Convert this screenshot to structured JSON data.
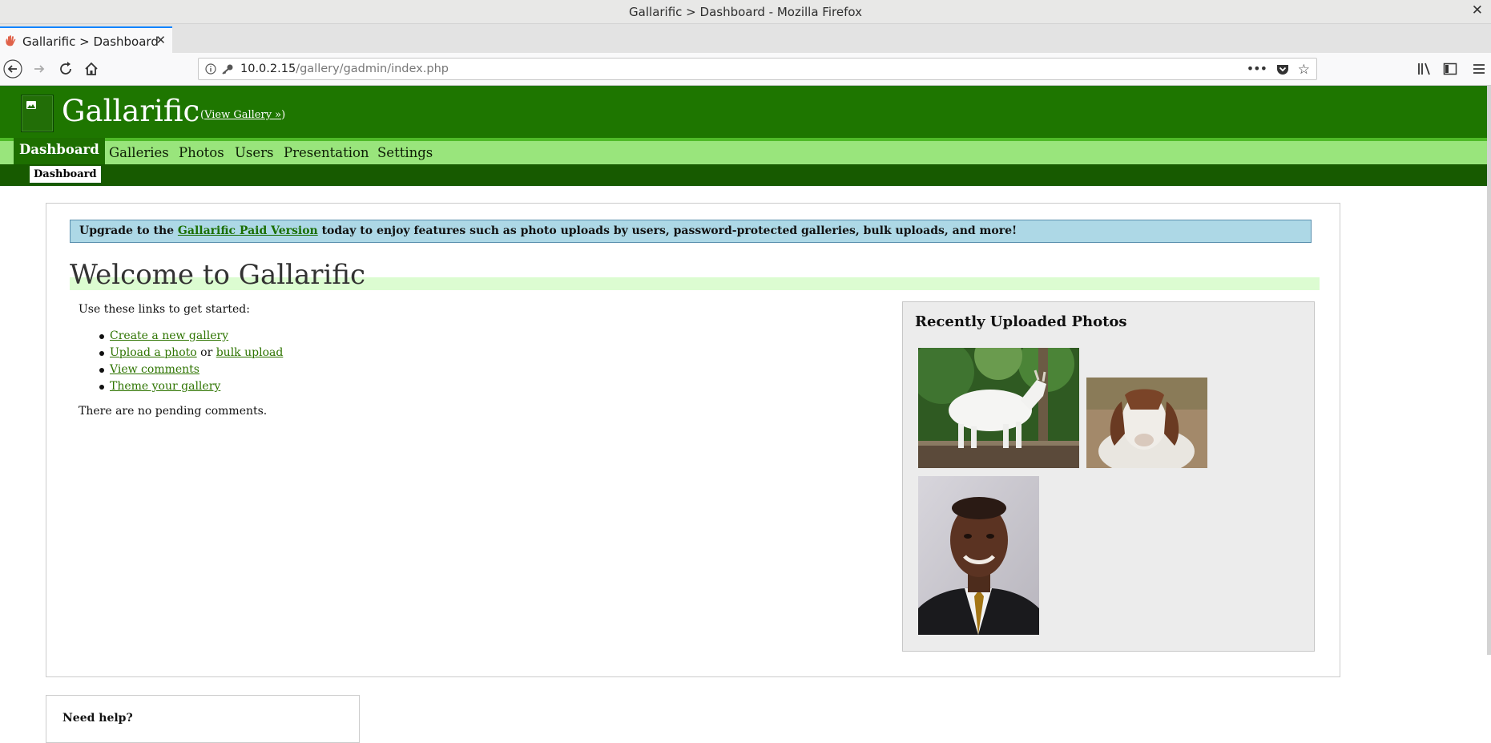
{
  "window": {
    "title": "Gallarific > Dashboard - Mozilla Firefox"
  },
  "browser": {
    "tab_label": "Gallarific > Dashboard",
    "url_host": "10.0.2.15",
    "url_path": "/gallery/gadmin/index.php",
    "icons": {
      "back": "back-arrow-icon",
      "forward": "forward-arrow-icon",
      "reload": "reload-icon",
      "home": "home-icon",
      "library": "library-icon",
      "sidebar": "sidebar-icon",
      "menu": "hamburger-menu-icon"
    }
  },
  "site": {
    "title": "Gallarific",
    "view_gallery_prefix": "(",
    "view_gallery_link": "View Gallery »",
    "view_gallery_suffix": ")"
  },
  "menu": {
    "items": [
      "Dashboard",
      "Galleries",
      "Photos",
      "Users",
      "Presentation",
      "Settings"
    ],
    "active": "Dashboard",
    "submenu": [
      "Dashboard"
    ]
  },
  "notice": {
    "prefix": "Upgrade to the ",
    "link": "Gallarific Paid Version",
    "suffix": " today to enjoy features such as photo uploads by users, password-protected galleries, bulk uploads, and more!"
  },
  "main": {
    "heading": "Welcome to Gallarific",
    "intro": "Use these links to get started:",
    "links": {
      "create_gallery": "Create a new gallery",
      "upload_photo": "Upload a photo",
      "or": " or ",
      "bulk_upload": "bulk upload",
      "view_comments": "View comments",
      "theme_gallery": "Theme your gallery"
    },
    "pending": "There are no pending comments."
  },
  "recent": {
    "title": "Recently Uploaded Photos",
    "photos": [
      "white goat on a fence",
      "brown and white goat",
      "portrait of a man in a suit"
    ]
  },
  "help": {
    "title": "Need help?"
  },
  "colors": {
    "header_green": "#1e7600",
    "menu_green": "#99e57c",
    "submenu_green": "#175a00",
    "notice_blue": "#add8e6",
    "link_green": "#2e7400"
  }
}
